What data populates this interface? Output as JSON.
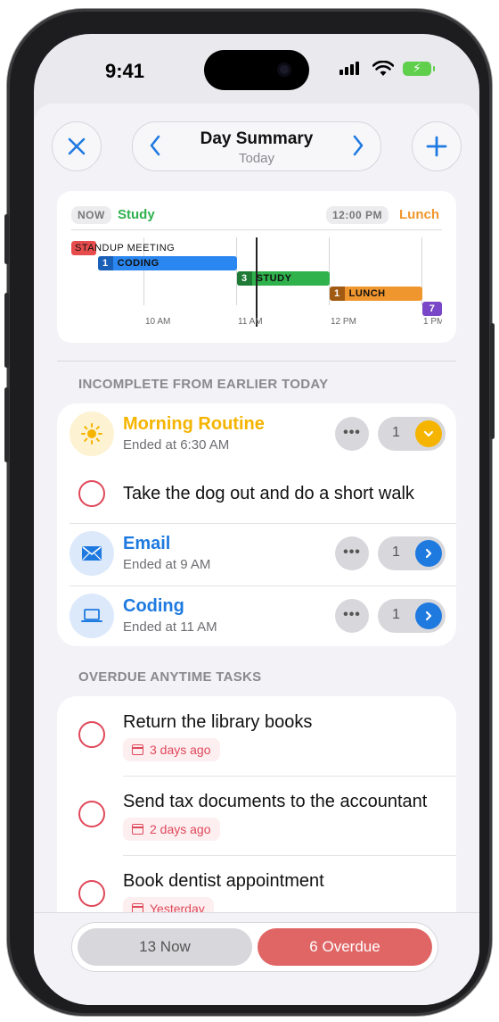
{
  "status_bar": {
    "time": "9:41"
  },
  "header": {
    "close_icon": "close-icon",
    "title": "Day Summary",
    "subtitle": "Today",
    "prev_icon": "chevron-left-icon",
    "next_icon": "chevron-right-icon",
    "add_icon": "plus-icon"
  },
  "timeline": {
    "now_tag": "NOW",
    "now_label": "Study",
    "next_tag": "12:00 PM",
    "next_label": "Lunch",
    "events": [
      {
        "num": "",
        "label": "STANDUP MEETING"
      },
      {
        "num": "1",
        "label": "CODING"
      },
      {
        "num": "3",
        "label": "STUDY"
      },
      {
        "num": "1",
        "label": "LUNCH"
      },
      {
        "num": "7",
        "label": ""
      }
    ],
    "hours": [
      "10 AM",
      "11 AM",
      "12 PM",
      "1 PM"
    ],
    "colors": {
      "standup": "#e74c4c",
      "coding": "#2a86f0",
      "study": "#2fb14c",
      "lunch": "#f0962e",
      "purple": "#7a47c8"
    }
  },
  "incomplete_section": {
    "header": "INCOMPLETE FROM EARLIER TODAY",
    "items": [
      {
        "title": "Morning Routine",
        "subtitle": "Ended at 6:30 AM",
        "count": "1",
        "icon": "sun-icon",
        "action_icon": "chevron-down-icon",
        "color": "#f5b400"
      },
      {
        "text": "Take the dog out and do a short walk"
      },
      {
        "title": "Email",
        "subtitle": "Ended at 9 AM",
        "count": "1",
        "icon": "envelope-icon",
        "action_icon": "chevron-right-icon",
        "color": "#1f7ae0"
      },
      {
        "title": "Coding",
        "subtitle": "Ended at 11 AM",
        "count": "1",
        "icon": "laptop-icon",
        "action_icon": "chevron-right-icon",
        "color": "#1f7ae0"
      }
    ]
  },
  "overdue_section": {
    "header": "OVERDUE ANYTIME TASKS",
    "items": [
      {
        "text": "Return the library books",
        "due": "3 days ago"
      },
      {
        "text": "Send tax documents to the accountant",
        "due": "2 days ago"
      },
      {
        "text": "Book dentist appointment",
        "due": "Yesterday"
      }
    ]
  },
  "bottom_segment": {
    "now_label": "13 Now",
    "overdue_label": "6 Overdue"
  }
}
